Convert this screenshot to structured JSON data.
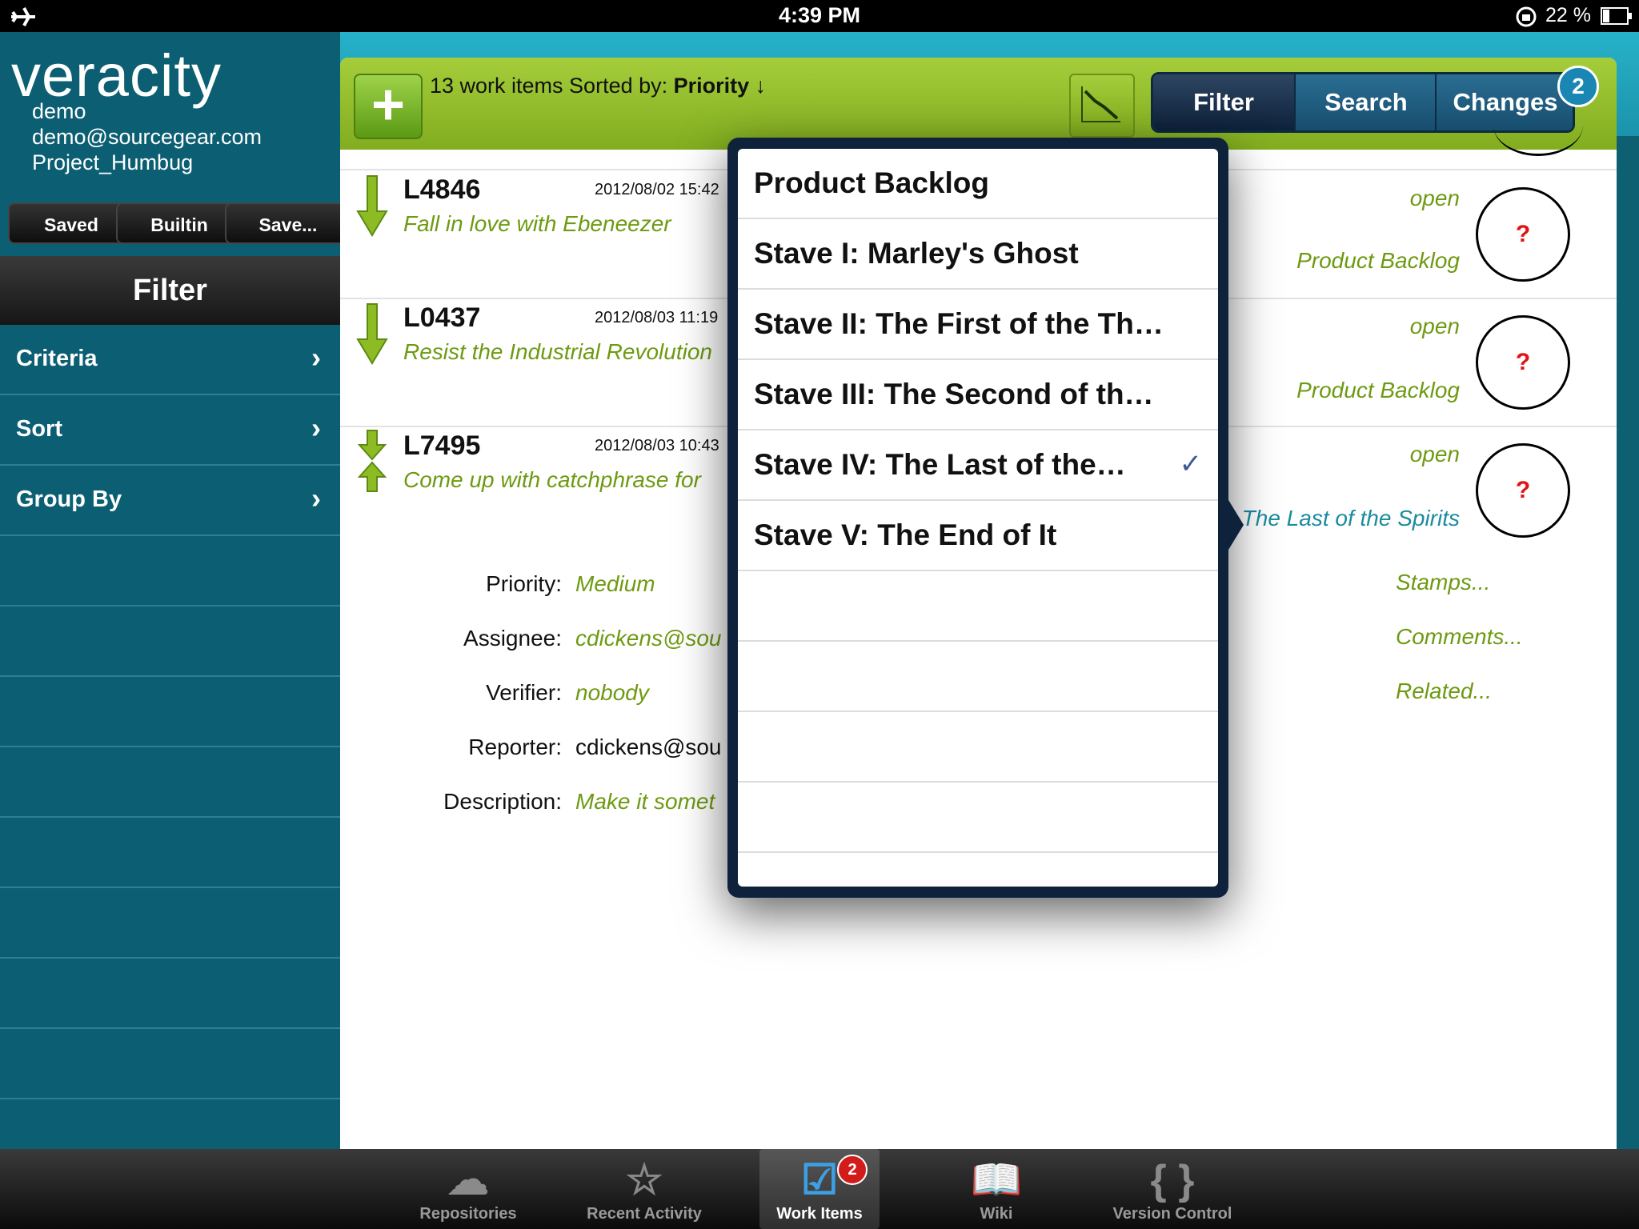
{
  "status_bar": {
    "time": "4:39 PM",
    "battery": "22 %"
  },
  "app": {
    "logo": "veracity",
    "user": "demo",
    "email": "demo@sourcegear.com",
    "project": "Project_Humbug"
  },
  "saved_buttons": [
    "Saved",
    "Builtin",
    "Save..."
  ],
  "sidebar": {
    "title": "Filter",
    "items": [
      {
        "label": "Criteria"
      },
      {
        "label": "Sort"
      },
      {
        "label": "Group By"
      }
    ]
  },
  "toolbar": {
    "count_text": "13 work items Sorted by: ",
    "sort_field": "Priority",
    "sort_dir": "↓",
    "segments": [
      "Filter",
      "Search",
      "Changes"
    ],
    "changes_badge": "2"
  },
  "items": [
    {
      "id": "L4846",
      "date": "2012/08/02 15:42",
      "title": "Fall in love with Ebeneezer",
      "status": "open",
      "milestone": "Product Backlog",
      "stamp": "?"
    },
    {
      "id": "L0437",
      "date": "2012/08/03 11:19",
      "title": "Resist the Industrial Revolution",
      "status": "open",
      "milestone": "Product Backlog",
      "stamp": "?"
    },
    {
      "id": "L7495",
      "date": "2012/08/03 10:43",
      "title": "Come up with catchphrase for",
      "status": "open",
      "milestone": "The Last of the Spirits",
      "stamp": "?"
    }
  ],
  "detail": {
    "priority_label": "Priority:",
    "priority": "Medium",
    "assignee_label": "Assignee:",
    "assignee": "cdickens@sou",
    "verifier_label": "Verifier:",
    "verifier": "nobody",
    "reporter_label": "Reporter:",
    "reporter": "cdickens@sou",
    "description_label": "Description:",
    "description": "Make it somet",
    "links": [
      "Stamps...",
      "Comments...",
      "Related..."
    ]
  },
  "popover": {
    "options": [
      {
        "label": "Product Backlog",
        "checked": false
      },
      {
        "label": "Stave I: Marley's Ghost",
        "checked": false
      },
      {
        "label": "Stave II: The First of the Th…",
        "checked": false
      },
      {
        "label": "Stave III: The Second of th…",
        "checked": false
      },
      {
        "label": "Stave IV: The Last of the…",
        "checked": true
      },
      {
        "label": "Stave V: The End of It",
        "checked": false
      }
    ],
    "check_mark": "✓"
  },
  "tabbar": {
    "tabs": [
      {
        "label": "Repositories",
        "icon": "cloud-lightning-icon"
      },
      {
        "label": "Recent Activity",
        "icon": "star-icon"
      },
      {
        "label": "Work Items",
        "icon": "checkbox-icon",
        "selected": true,
        "badge": "2"
      },
      {
        "label": "Wiki",
        "icon": "book-icon"
      },
      {
        "label": "Version Control",
        "icon": "braces-icon"
      }
    ]
  },
  "colors": {
    "accent_green": "#8fbc2a",
    "sidebar_teal": "#0c5f73",
    "popover_navy": "#0f223c",
    "link_green": "#6e9a12"
  }
}
